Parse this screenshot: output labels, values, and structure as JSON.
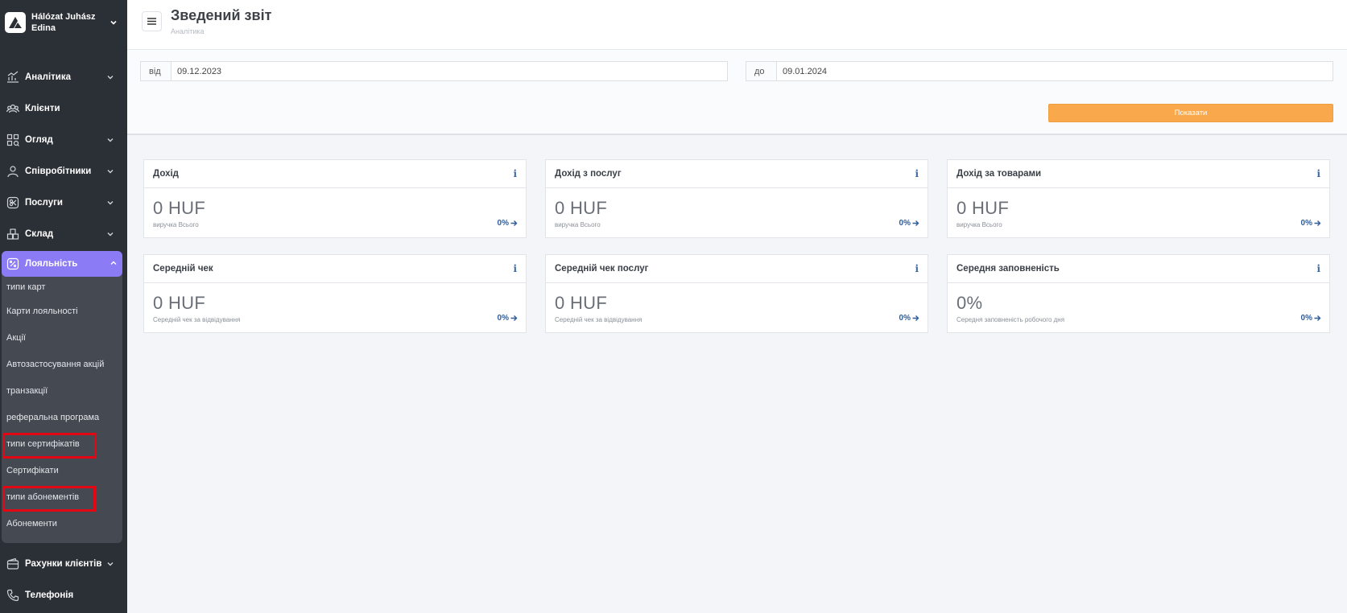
{
  "user": {
    "name": "Hálózat Juhász Edina"
  },
  "nav": {
    "items_top": [
      {
        "label": "Аналітика",
        "icon": "analytics-icon",
        "has_chevron": true
      },
      {
        "label": "Клієнти",
        "icon": "clients-icon",
        "has_chevron": false
      },
      {
        "label": "Огляд",
        "icon": "overview-icon",
        "has_chevron": true
      },
      {
        "label": "Співробітники",
        "icon": "employees-icon",
        "has_chevron": true
      },
      {
        "label": "Послуги",
        "icon": "services-icon",
        "has_chevron": true
      },
      {
        "label": "Склад",
        "icon": "warehouse-icon",
        "has_chevron": true
      }
    ],
    "loyalty": {
      "label": "Лояльність",
      "icon": "loyalty-icon",
      "sub_items": [
        "типи карт",
        "Карти лояльності",
        "Акції",
        "Автозастосування акцій",
        "транзакції",
        "реферальна програма",
        "типи сертифікатів",
        "Сертифікати",
        "типи абонементів",
        "Абонементи"
      ]
    },
    "items_bottom": [
      {
        "label": "Рахунки клієнтів",
        "icon": "wallet-icon",
        "has_chevron": true
      },
      {
        "label": "Телефонія",
        "icon": "phone-icon",
        "has_chevron": false
      }
    ]
  },
  "header": {
    "title": "Зведений звіт",
    "breadcrumb": "Аналітика"
  },
  "filter": {
    "from_label": "від",
    "from_value": "09.12.2023",
    "to_label": "до",
    "to_value": "09.01.2024",
    "show_button": "Показати"
  },
  "cards": [
    {
      "title": "Дохід",
      "value": "0 HUF",
      "sub": "виручка Всього",
      "pct": "0%"
    },
    {
      "title": "Дохід з послуг",
      "value": "0 HUF",
      "sub": "виручка Всього",
      "pct": "0%"
    },
    {
      "title": "Дохід за товарами",
      "value": "0 HUF",
      "sub": "виручка Всього",
      "pct": "0%"
    },
    {
      "title": "Середній чек",
      "value": "0 HUF",
      "sub": "Середній чек за відвідування",
      "pct": "0%"
    },
    {
      "title": "Середній чек послуг",
      "value": "0 HUF",
      "sub": "Середній чек за відвідування",
      "pct": "0%"
    },
    {
      "title": "Середня заповненість",
      "value": "0%",
      "sub": "Середня заповненість робочого дня",
      "pct": "0%"
    }
  ],
  "colors": {
    "sidebar": "#2b3036",
    "accent": "#8b7cf6",
    "button": "#f9a94b",
    "link": "#2f5d9a",
    "highlight": "#e30613"
  }
}
